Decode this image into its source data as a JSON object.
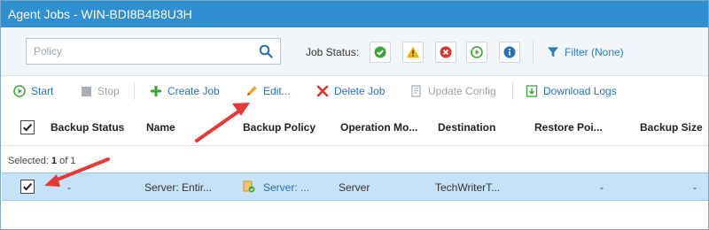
{
  "window": {
    "title": "Agent Jobs - WIN-BDI8B4B8U3H"
  },
  "filters": {
    "search_placeholder": "Policy",
    "job_status_label": "Job Status:",
    "status_buttons": [
      {
        "name": "success",
        "color": "#3aa53a"
      },
      {
        "name": "warning",
        "color": "#f0b400"
      },
      {
        "name": "failed",
        "color": "#d9342b"
      },
      {
        "name": "running",
        "color": "#3aa53a"
      },
      {
        "name": "info",
        "color": "#2a6fb5"
      }
    ],
    "filter_label": "Filter (None)"
  },
  "toolbar": {
    "start": "Start",
    "stop": "Stop",
    "create_job": "Create Job",
    "edit": "Edit...",
    "delete_job": "Delete Job",
    "update_config": "Update Config",
    "download_logs": "Download Logs"
  },
  "table": {
    "columns": [
      "Backup Status",
      "Name",
      "Backup Policy",
      "Operation Mo...",
      "Destination",
      "Restore Poi...",
      "Backup Size"
    ],
    "selection_prefix": "Selected:",
    "selected_count": "1",
    "selection_suffix": "of 1",
    "rows": [
      {
        "checked": true,
        "backup_status": "-",
        "name": "Server: Entir...",
        "backup_policy": "Server: ...",
        "operation_mode": "Server",
        "destination": "TechWriterT...",
        "restore_points": "-",
        "backup_size": "-"
      }
    ]
  },
  "colors": {
    "title_bar": "#2f8fd0",
    "selected_row": "#c5e2f7",
    "link": "#2a6fb5",
    "annotation_arrow": "#e53935"
  }
}
